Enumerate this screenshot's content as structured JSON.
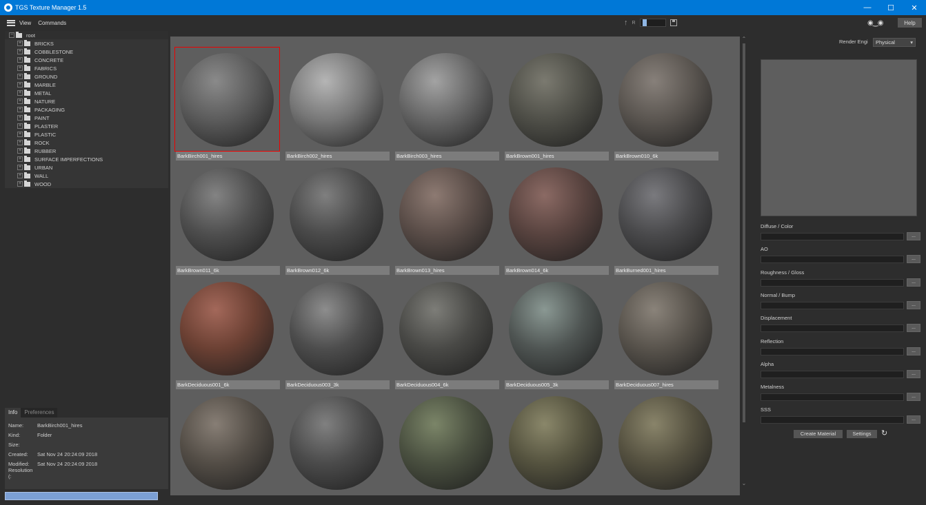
{
  "window": {
    "title": "TGS Texture Manager 1.5",
    "controls": [
      "—",
      "☐",
      "✕"
    ]
  },
  "menu": {
    "items": [
      "View",
      "Commands"
    ]
  },
  "toolbar": {
    "slider_label": "R",
    "help_label": "Help"
  },
  "tree": {
    "root_label": "root",
    "items": [
      "BRICKS",
      "COBBLESTONE",
      "CONCRETE",
      "FABRICS",
      "GROUND",
      "MARBLE",
      "METAL",
      "NATURE",
      "PACKAGING",
      "PAINT",
      "PLASTER",
      "PLASTIC",
      "ROCK",
      "RUBBER",
      "SURFACE IMPERFECTIONS",
      "URBAN",
      "WALL",
      "WOOD"
    ]
  },
  "info": {
    "tabs": [
      "Info",
      "Preferences"
    ],
    "rows": [
      {
        "key": "Name:",
        "value": "BarkBirch001_hires"
      },
      {
        "key": "Kind:",
        "value": "Folder"
      },
      {
        "key": "Size:",
        "value": ""
      },
      {
        "key": "Created:",
        "value": "Sat Nov 24 20:24:09 2018"
      },
      {
        "key": "Modified:",
        "value": "Sat Nov 24 20:24:09 2018"
      },
      {
        "key": "Resolution (:",
        "value": ""
      }
    ]
  },
  "materials": [
    {
      "label": "BarkBirch001_hires",
      "color": "#5b5b5b",
      "highlight": "#8a8a8a"
    },
    {
      "label": "BarkBirch002_hires",
      "color": "#777777",
      "highlight": "#b5b5b5"
    },
    {
      "label": "BarkBirch003_hires",
      "color": "#666666",
      "highlight": "#a3a3a3"
    },
    {
      "label": "BarkBrown001_hires",
      "color": "#4f4f48",
      "highlight": "#7b7a70"
    },
    {
      "label": "BarkBrown010_6k",
      "color": "#5a5550",
      "highlight": "#87807a"
    },
    {
      "label": "BarkBrown011_6k",
      "color": "#4e4e4e",
      "highlight": "#838383"
    },
    {
      "label": "BarkBrown012_6k",
      "color": "#4a4a4a",
      "highlight": "#7f7f7f"
    },
    {
      "label": "BarkBrown013_hires",
      "color": "#5a4d48",
      "highlight": "#8d7a72"
    },
    {
      "label": "BarkBrown014_6k",
      "color": "#58433f",
      "highlight": "#8b6a64"
    },
    {
      "label": "BarkBurned001_hires",
      "color": "#4a4a4c",
      "highlight": "#7a7a7e"
    },
    {
      "label": "BarkDeciduous001_6k",
      "color": "#6b4033",
      "highlight": "#a3685a"
    },
    {
      "label": "BarkDeciduous003_3k",
      "color": "#4d4d4d",
      "highlight": "#8d8d8d"
    },
    {
      "label": "BarkDeciduous004_6k",
      "color": "#494946",
      "highlight": "#7d7d78"
    },
    {
      "label": "BarkDeciduous005_3k",
      "color": "#4f5553",
      "highlight": "#8a9893"
    },
    {
      "label": "BarkDeciduous007_hires",
      "color": "#58534c",
      "highlight": "#8a837a"
    },
    {
      "label": "",
      "color": "#534d46",
      "highlight": "#877e75"
    },
    {
      "label": "",
      "color": "#4b4b4b",
      "highlight": "#808080"
    },
    {
      "label": "",
      "color": "#4a5040",
      "highlight": "#7b8568"
    },
    {
      "label": "",
      "color": "#55533f",
      "highlight": "#8a876a"
    },
    {
      "label": "",
      "color": "#555140",
      "highlight": "#89846a"
    }
  ],
  "selected_index": 0,
  "right_panel": {
    "render_engine_label": "Render Engi",
    "render_engine_value": "Physical",
    "slots": [
      "Diffuse / Color",
      "AO",
      "Roughness / Gloss",
      "Normal / Bump",
      "Displacement",
      "Reflection",
      "Alpha",
      "Metalness",
      "SSS"
    ],
    "slot_button": "...",
    "create_label": "Create Material",
    "settings_label": "Settings"
  }
}
